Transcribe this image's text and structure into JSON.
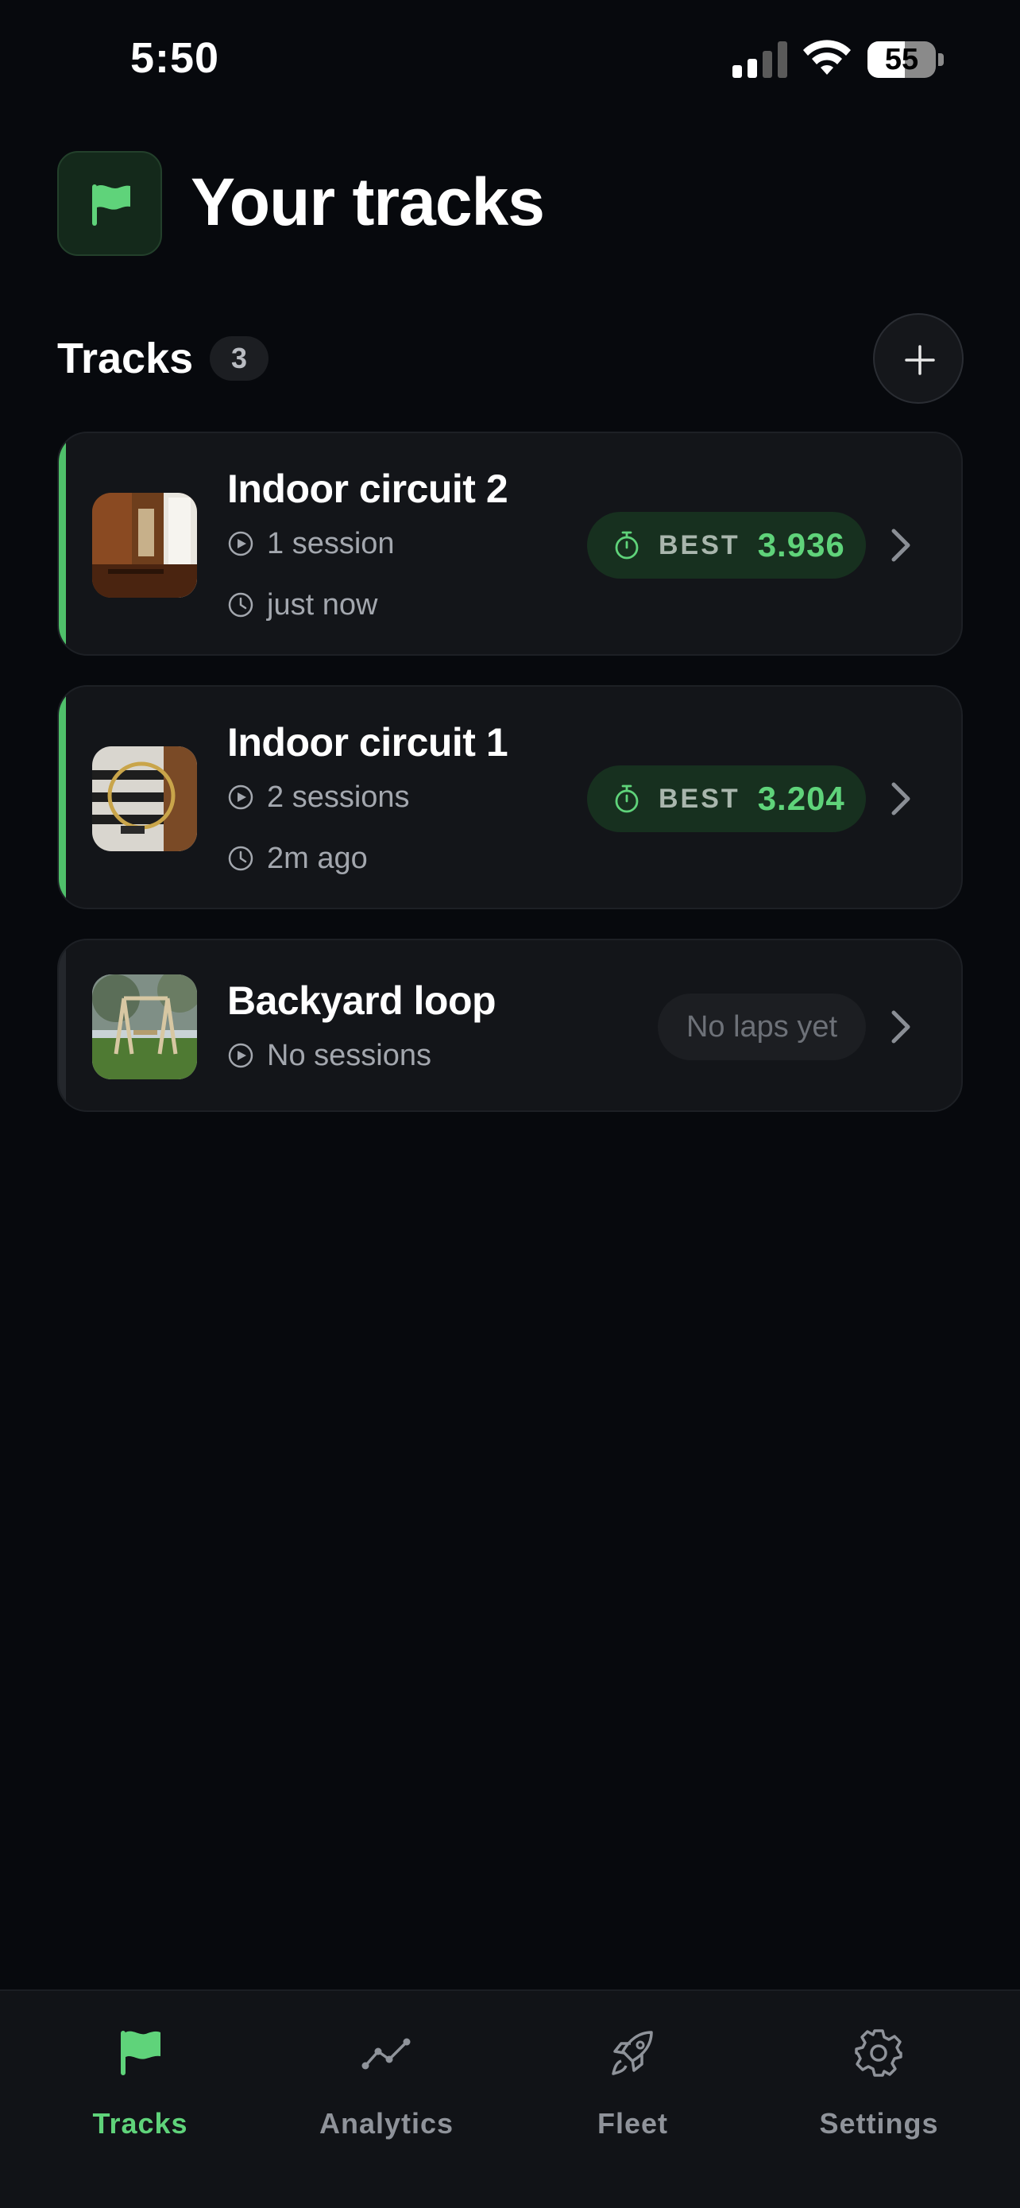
{
  "status_bar": {
    "time": "5:50",
    "battery_level": "55",
    "battery_fraction": 0.55
  },
  "header": {
    "title": "Your tracks",
    "logo_icon": "flag-icon"
  },
  "section": {
    "title": "Tracks",
    "count": "3",
    "add_icon": "plus-icon"
  },
  "colors": {
    "accent_green": "#5fd37a",
    "background": "#07090d",
    "card": "#131519"
  },
  "tracks": [
    {
      "name": "Indoor circuit 2",
      "sessions": "1 session",
      "updated": "just now",
      "best_label": "BEST",
      "best_time": "3.936",
      "active": true
    },
    {
      "name": "Indoor circuit 1",
      "sessions": "2 sessions",
      "updated": "2m ago",
      "best_label": "BEST",
      "best_time": "3.204",
      "active": true
    },
    {
      "name": "Backyard loop",
      "sessions": "No sessions",
      "no_laps": "No laps yet",
      "active": false
    }
  ],
  "tab_bar": {
    "tabs": [
      {
        "label": "Tracks",
        "icon": "flag-icon",
        "active": true
      },
      {
        "label": "Analytics",
        "icon": "analytics-icon",
        "active": false
      },
      {
        "label": "Fleet",
        "icon": "rocket-icon",
        "active": false
      },
      {
        "label": "Settings",
        "icon": "gear-icon",
        "active": false
      }
    ]
  }
}
